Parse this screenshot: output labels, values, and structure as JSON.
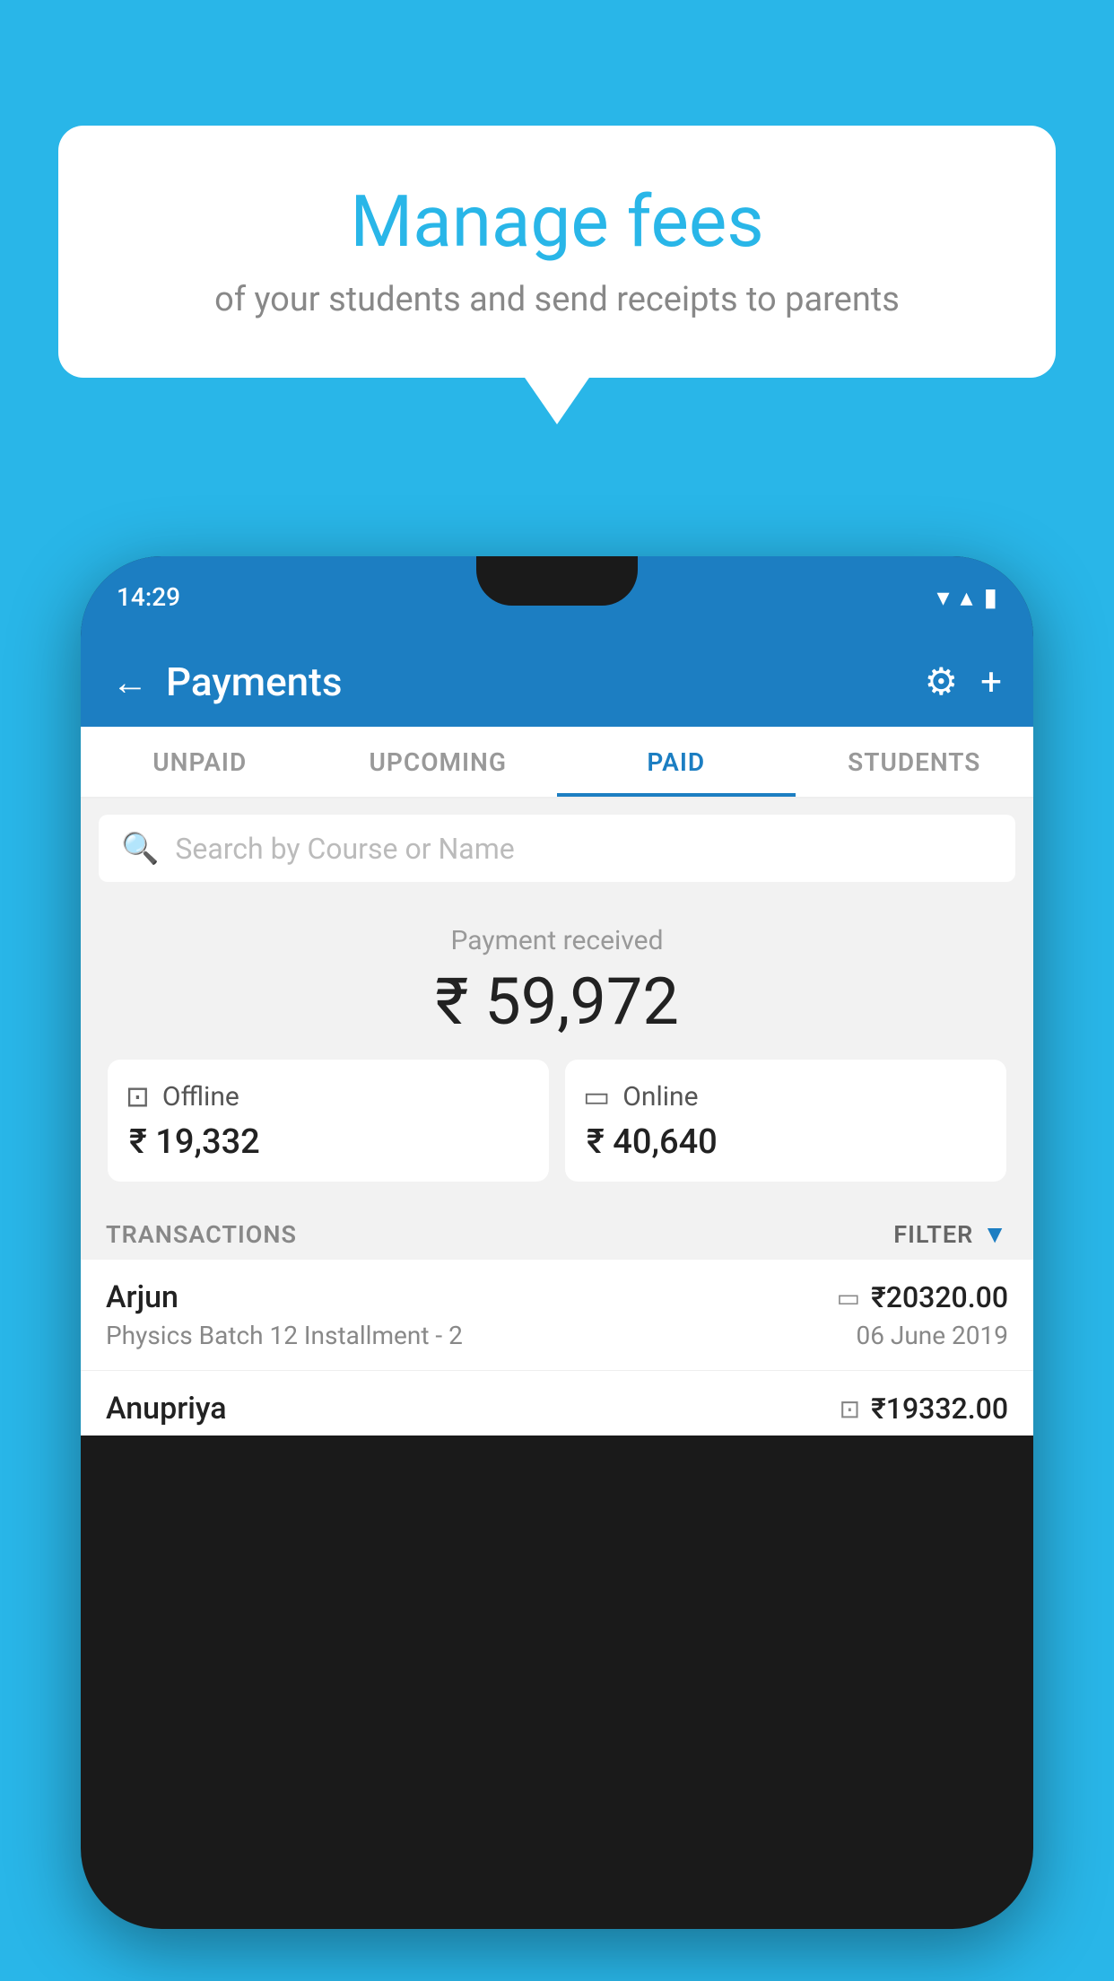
{
  "background_color": "#29b6e8",
  "speech_bubble": {
    "title": "Manage fees",
    "subtitle": "of your students and send receipts to parents"
  },
  "status_bar": {
    "time": "14:29",
    "wifi": "▼",
    "signal": "▲",
    "battery": "■"
  },
  "header": {
    "title": "Payments",
    "back_label": "←",
    "gear_label": "⚙",
    "plus_label": "+"
  },
  "tabs": [
    {
      "id": "unpaid",
      "label": "UNPAID",
      "active": false
    },
    {
      "id": "upcoming",
      "label": "UPCOMING",
      "active": false
    },
    {
      "id": "paid",
      "label": "PAID",
      "active": true
    },
    {
      "id": "students",
      "label": "STUDENTS",
      "active": false
    }
  ],
  "search": {
    "placeholder": "Search by Course or Name"
  },
  "payment_summary": {
    "label": "Payment received",
    "amount": "₹ 59,972",
    "offline": {
      "label": "Offline",
      "amount": "₹ 19,332"
    },
    "online": {
      "label": "Online",
      "amount": "₹ 40,640"
    }
  },
  "transactions": {
    "header_label": "TRANSACTIONS",
    "filter_label": "FILTER",
    "rows": [
      {
        "name": "Arjun",
        "course": "Physics Batch 12 Installment - 2",
        "amount": "₹20320.00",
        "date": "06 June 2019",
        "type": "online"
      },
      {
        "name": "Anupriya",
        "course": "",
        "amount": "₹19332.00",
        "date": "",
        "type": "offline"
      }
    ]
  }
}
